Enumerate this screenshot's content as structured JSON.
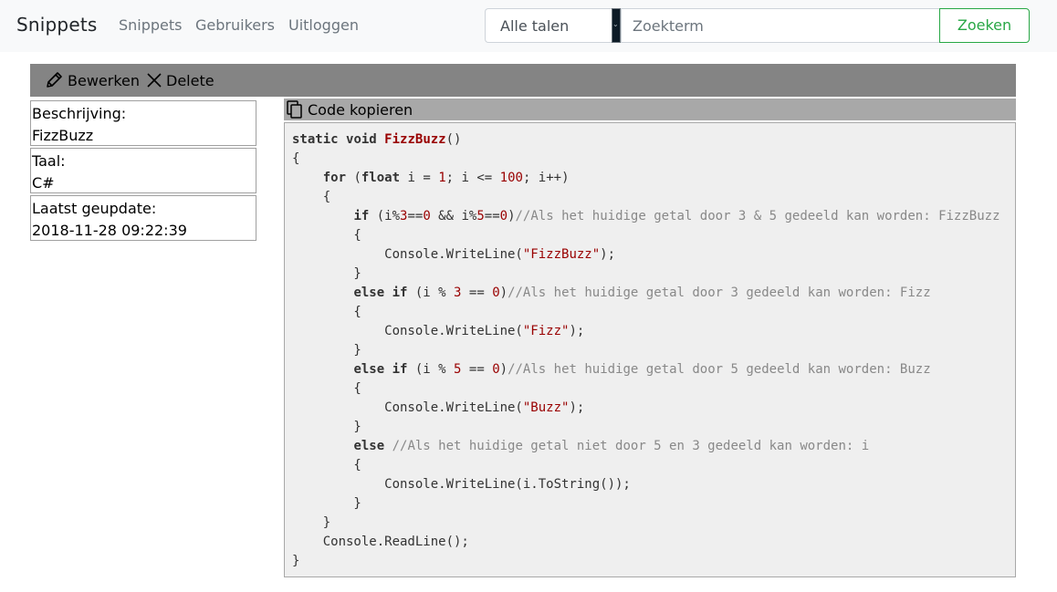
{
  "navbar": {
    "brand": "Snippets",
    "links": [
      "Snippets",
      "Gebruikers",
      "Uitloggen"
    ],
    "language_select": "Alle talen",
    "search_placeholder": "Zoekterm",
    "search_button": "Zoeken"
  },
  "toolbar": {
    "edit_label": "Bewerken",
    "delete_label": "Delete"
  },
  "info": {
    "description_label": "Beschrijving:",
    "description_value": "FizzBuzz",
    "language_label": "Taal:",
    "language_value": "C#",
    "updated_label": "Laatst geupdate:",
    "updated_value": "2018-11-28 09:22:39"
  },
  "code": {
    "copy_label": "Code kopieren",
    "text": "static void FizzBuzz()\n{\n    for (float i = 1; i <= 100; i++)\n    {\n        if (i%3==0 && i%5==0)//Als het huidige getal door 3 & 5 gedeeld kan worden: FizzBuzz\n        {\n            Console.WriteLine(\"FizzBuzz\");\n        }\n        else if (i % 3 == 0)//Als het huidige getal door 3 gedeeld kan worden: Fizz\n        {\n            Console.WriteLine(\"Fizz\");\n        }\n        else if (i % 5 == 0)//Als het huidige getal door 5 gedeeld kan worden: Buzz\n        {\n            Console.WriteLine(\"Buzz\");\n        }\n        else //Als het huidige getal niet door 5 en 3 gedeeld kan worden: i\n        {\n            Console.WriteLine(i.ToString());\n        }\n    }\n    Console.ReadLine();\n}",
    "language": "csharp"
  },
  "colors": {
    "accent_green": "#28a745",
    "toolbar_bg": "#848484",
    "copy_bar_bg": "#a8a8a8",
    "code_bg": "#efefef"
  }
}
